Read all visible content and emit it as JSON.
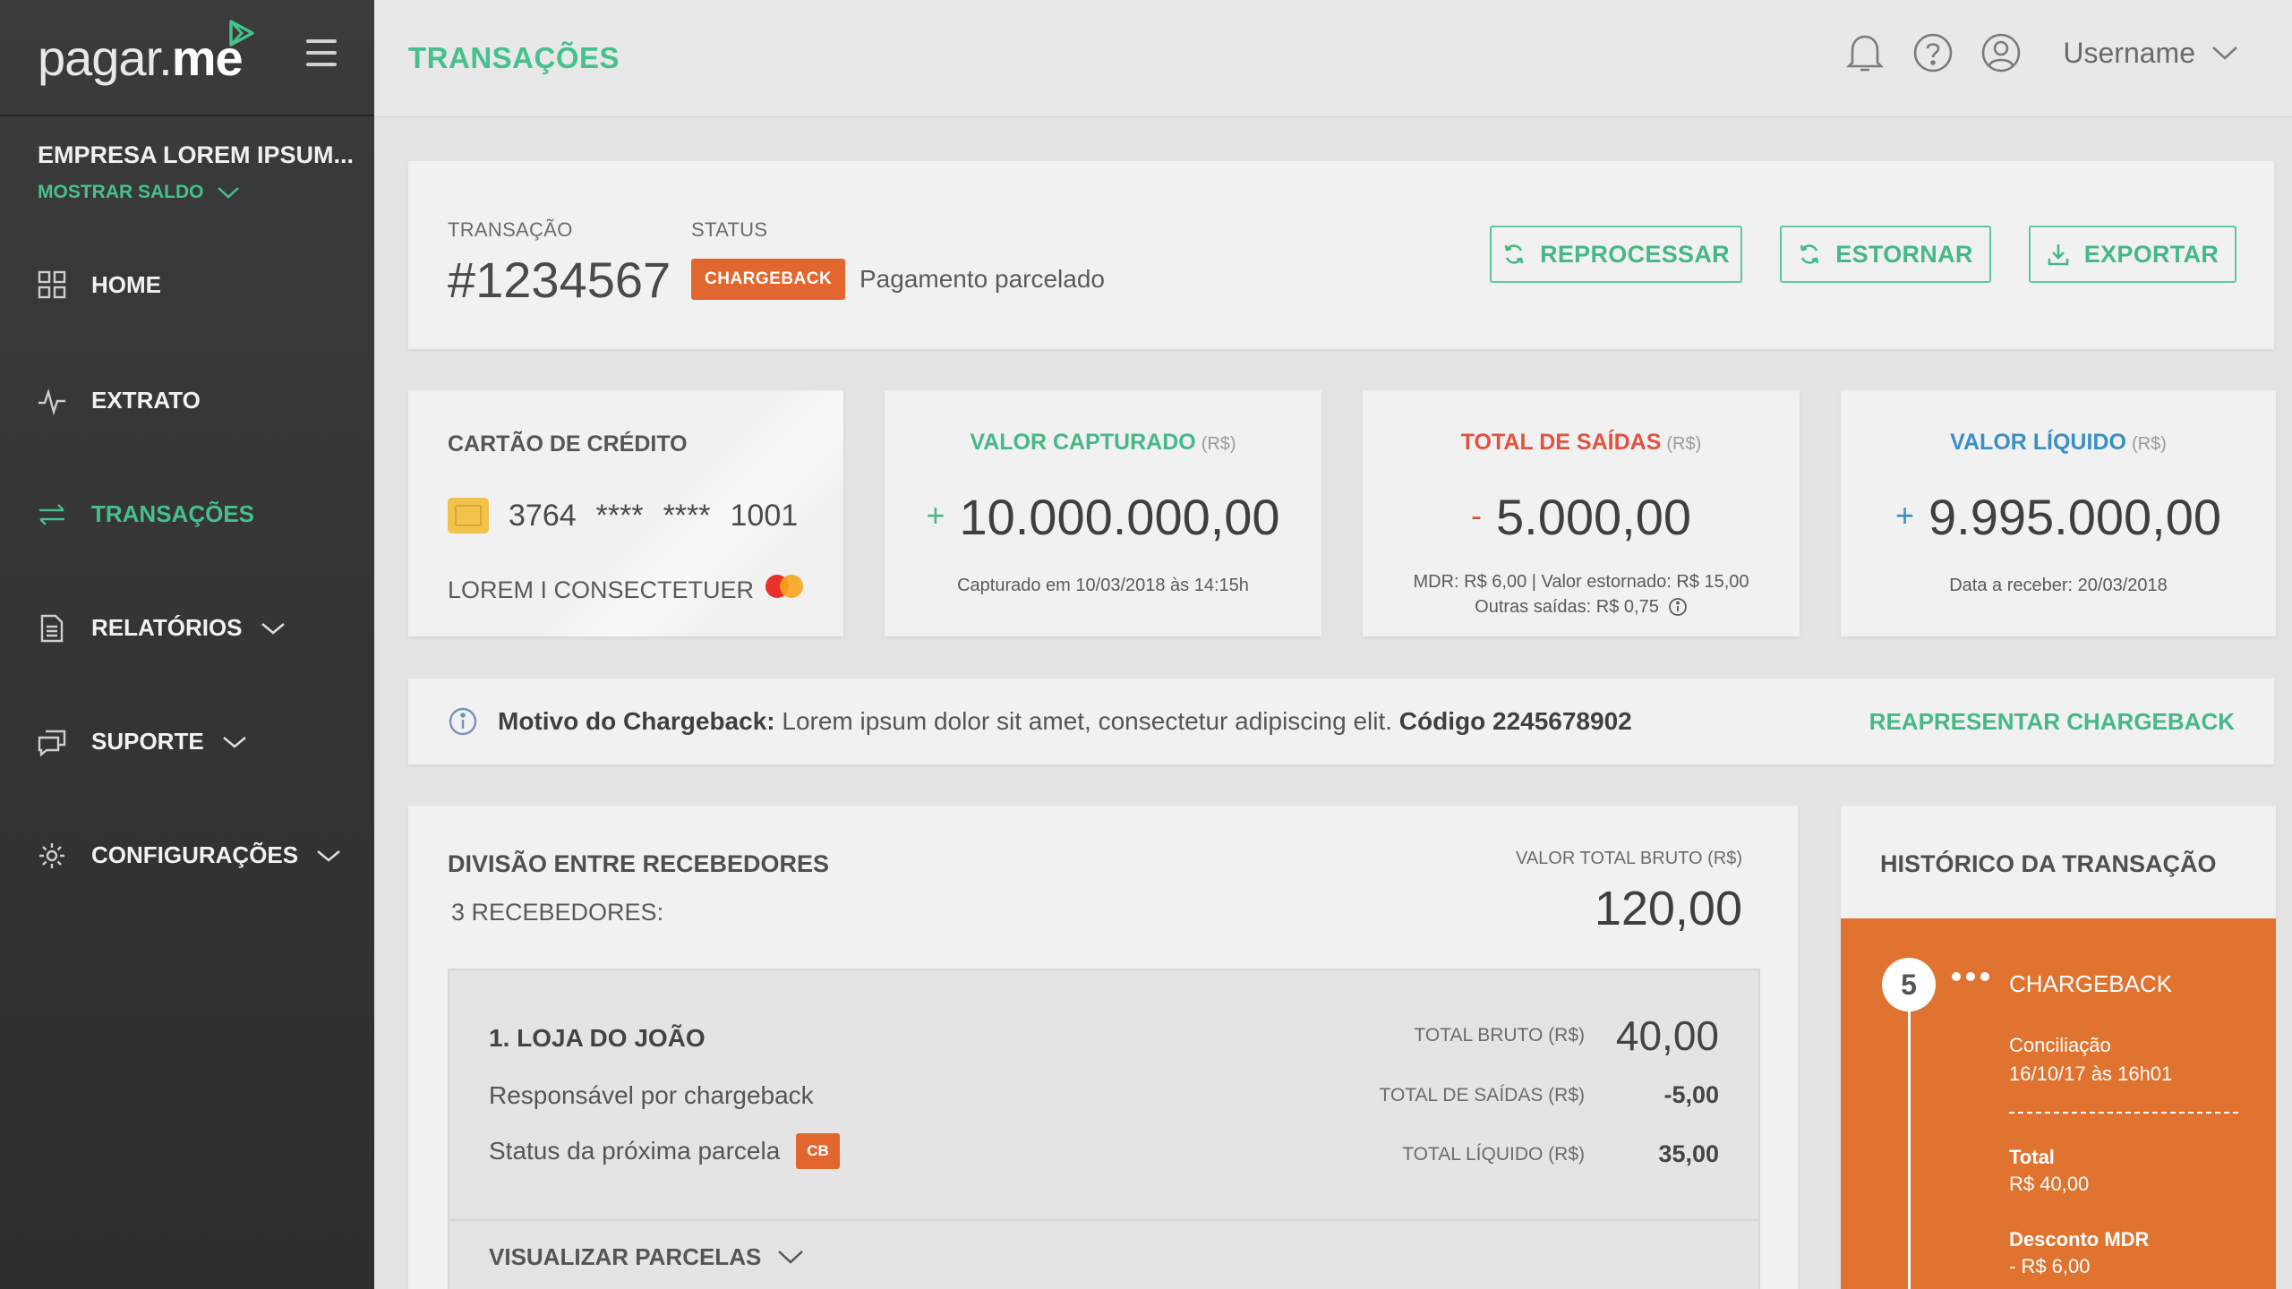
{
  "sidebar": {
    "logo_light": "pagar.",
    "logo_bold": "me",
    "company": "EMPRESA LOREM IPSUM...",
    "show_balance": "MOSTRAR SALDO",
    "items": [
      {
        "label": "HOME",
        "icon": "grid-icon"
      },
      {
        "label": "EXTRATO",
        "icon": "pulse-icon"
      },
      {
        "label": "TRANSAÇÕES",
        "icon": "transfer-arrows-icon",
        "active": true
      },
      {
        "label": "RELATÓRIOS",
        "icon": "document-icon"
      },
      {
        "label": "SUPORTE",
        "icon": "chat-icon"
      },
      {
        "label": "CONFIGURAÇÕES",
        "icon": "gear-icon"
      }
    ]
  },
  "header": {
    "title": "TRANSAÇÕES",
    "username": "Username"
  },
  "transaction": {
    "id_label": "TRANSAÇÃO",
    "status_label": "STATUS",
    "id": "#1234567",
    "status": "CHARGEBACK",
    "description": "Pagamento parcelado",
    "buttons": {
      "reprocess": "REPROCESSAR",
      "refund": "ESTORNAR",
      "export": "EXPORTAR"
    }
  },
  "card_info": {
    "title": "CARTÃO DE CRÉDITO",
    "first": "3764",
    "mask1": "****",
    "mask2": "****",
    "last": "1001",
    "holder": "LOREM I CONSECTETUER"
  },
  "stats": {
    "captured": {
      "title": "VALOR CAPTURADO",
      "unit": "(R$)",
      "sign": "+",
      "value": "10.000.000,00",
      "sub": "Capturado em 10/03/2018 às 14:15h",
      "color": "#46b887"
    },
    "outflows": {
      "title": "TOTAL DE SAÍDAS",
      "unit": "(R$)",
      "sign": "-",
      "value": "5.000,00",
      "sub1": "MDR: R$ 6,00 | Valor estornado: R$ 15,00",
      "sub2": "Outras saídas: R$ 0,75",
      "color": "#e0533f"
    },
    "net": {
      "title": "VALOR LÍQUIDO",
      "unit": "(R$)",
      "sign": "+",
      "value": "9.995.000,00",
      "sub": "Data a receber: 20/03/2018",
      "color": "#3a8fc4"
    }
  },
  "alert": {
    "label": "Motivo do Chargeback:",
    "text": " Lorem ipsum dolor sit amet, consectetur adipiscing elit. ",
    "code": "Código 2245678902",
    "action": "REAPRESENTAR CHARGEBACK"
  },
  "division": {
    "title": "DIVISÃO ENTRE RECEBEDORES",
    "subtitle": "3 RECEBEDORES:",
    "total_label": "VALOR TOTAL BRUTO (R$)",
    "total": "120,00",
    "receiver": {
      "name": "1. LOJA DO JOÃO",
      "line1": "Responsável por chargeback",
      "line2": "Status da próxima parcela",
      "badge": "CB",
      "gross_label": "TOTAL BRUTO (R$)",
      "gross": "40,00",
      "out_label": "TOTAL DE SAÍDAS (R$)",
      "out": "-5,00",
      "net_label": "TOTAL LÍQUIDO (R$)",
      "net": "35,00",
      "footer": "VISUALIZAR PARCELAS"
    }
  },
  "history": {
    "title": "HISTÓRICO DA TRANSAÇÃO",
    "step": "5",
    "event": "CHARGEBACK",
    "sub1": "Conciliação",
    "sub2": "16/10/17 às 16h01",
    "k1": "Total",
    "v1": "R$ 40,00",
    "k2": "Desconto MDR",
    "v2": "- R$ 6,00"
  }
}
